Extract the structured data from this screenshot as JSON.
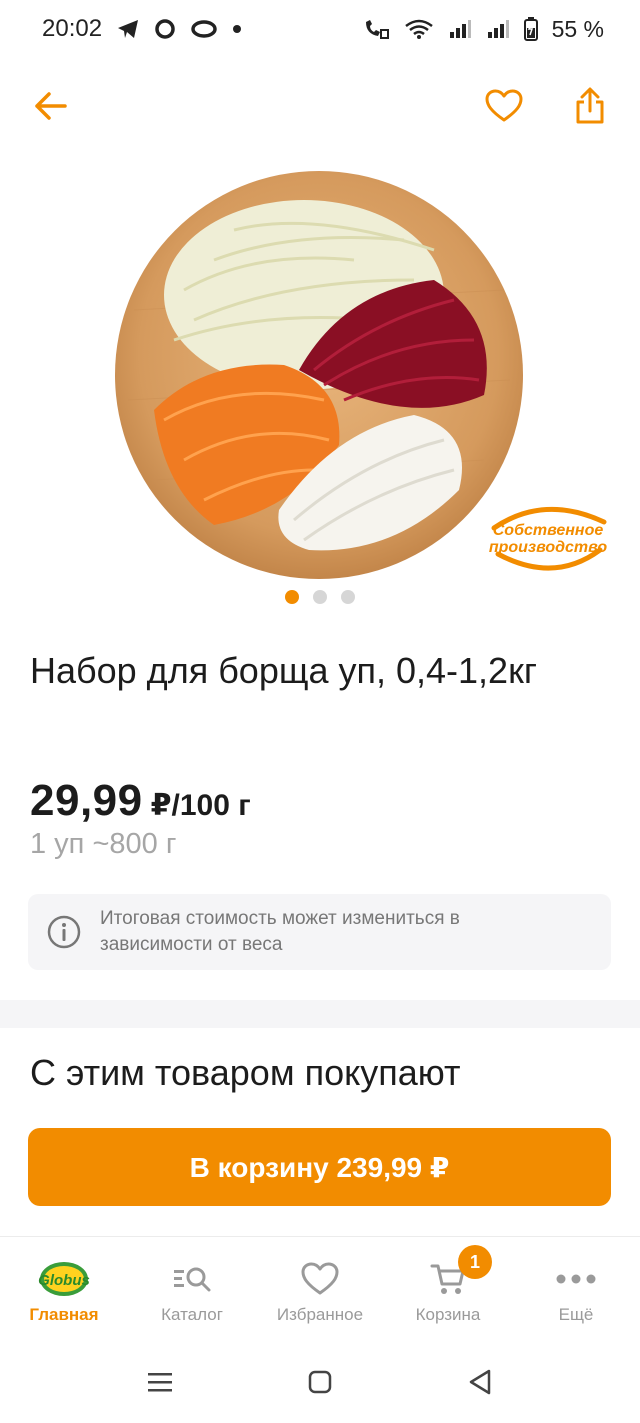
{
  "status_bar": {
    "time": "20:02",
    "battery": "55 %",
    "left_icons": [
      "telegram-icon",
      "chat-icon",
      "loop-icon",
      "dot-icon"
    ],
    "right_icons": [
      "wifi-call-icon",
      "wifi-icon",
      "signal-icon",
      "signal-icon",
      "battery-icon"
    ]
  },
  "header": {
    "back_icon": "arrow-left-icon",
    "favorite_icon": "heart-icon",
    "share_icon": "share-icon"
  },
  "product": {
    "badge_line1": "Собственное",
    "badge_line2": "производство",
    "carousel_count": 3,
    "carousel_active": 0,
    "title": "Набор для борща уп, 0,4-1,2кг",
    "price": "29,99",
    "price_unit": "₽/100 г",
    "pack_info": "1 уп ~800 г",
    "info_text": "Итоговая стоимость может измениться в зависимости от веса"
  },
  "related": {
    "title": "С этим товаром покупают"
  },
  "cart_button": {
    "label": "В корзину 239,99 ₽"
  },
  "bottom_nav": {
    "items": [
      {
        "label": "Главная",
        "icon": "globus-logo-icon",
        "active": true
      },
      {
        "label": "Каталог",
        "icon": "catalog-search-icon",
        "active": false
      },
      {
        "label": "Избранное",
        "icon": "heart-icon",
        "active": false
      },
      {
        "label": "Корзина",
        "icon": "cart-icon",
        "active": false,
        "badge": "1"
      },
      {
        "label": "Ещё",
        "icon": "more-dots-icon",
        "active": false
      }
    ],
    "logo_text": "Globus"
  },
  "colors": {
    "accent": "#f28c00",
    "text": "#1c1c1c",
    "muted": "#a6a6a6",
    "panel": "#f5f5f7"
  }
}
